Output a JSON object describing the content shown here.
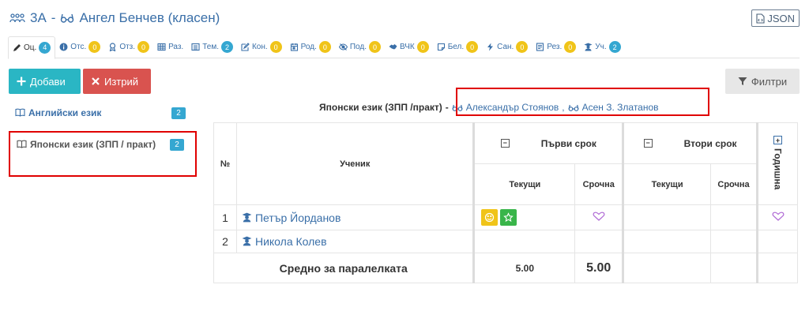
{
  "header": {
    "class_name": "3А",
    "separator": "-",
    "teacher": "Ангел Бенчев (класен)",
    "json_label": "JSON"
  },
  "tabs": [
    {
      "label": "Оц.",
      "count": "4",
      "color": "#35a7d1",
      "icon": "pencil-icon",
      "active": true
    },
    {
      "label": "Отс.",
      "count": "0",
      "color": "#f0c419",
      "icon": "info-icon"
    },
    {
      "label": "Отз.",
      "count": "0",
      "color": "#f0c419",
      "icon": "ribbon-icon"
    },
    {
      "label": "Раз.",
      "count": "",
      "icon": "table-icon"
    },
    {
      "label": "Тем.",
      "count": "2",
      "color": "#35a7d1",
      "icon": "list-icon"
    },
    {
      "label": "Кон.",
      "count": "0",
      "color": "#f0c419",
      "icon": "edit-icon"
    },
    {
      "label": "Род.",
      "count": "0",
      "color": "#f0c419",
      "icon": "calendar-icon"
    },
    {
      "label": "Под.",
      "count": "0",
      "color": "#f0c419",
      "icon": "eye-slash-icon"
    },
    {
      "label": "ВЧК",
      "count": "0",
      "color": "#f0c419",
      "icon": "handshake-icon"
    },
    {
      "label": "Бел.",
      "count": "0",
      "color": "#f0c419",
      "icon": "note-icon"
    },
    {
      "label": "Сан.",
      "count": "0",
      "color": "#f0c419",
      "icon": "bolt-icon"
    },
    {
      "label": "Рез.",
      "count": "0",
      "color": "#f0c419",
      "icon": "report-icon"
    },
    {
      "label": "Уч.",
      "count": "2",
      "color": "#35a7d1",
      "icon": "student-icon"
    }
  ],
  "toolbar": {
    "add_label": "Добави",
    "delete_label": "Изтрий",
    "filter_label": "Филтри"
  },
  "subjects": [
    {
      "name": "Английски език",
      "count": "2"
    },
    {
      "name": "Японски език (ЗПП / практ)",
      "count": "2"
    }
  ],
  "selected": {
    "subject": "Японски език (ЗПП /практ)",
    "dash": "-",
    "teacher1": "Александър Стоянов",
    "comma": ",",
    "teacher2": "Асен З. Златанов"
  },
  "table": {
    "col_no": "№",
    "col_student": "Ученик",
    "term1": "Първи срок",
    "term2": "Втори срок",
    "current": "Текущи",
    "term_grade": "Срочна",
    "year": "Годишна",
    "rows": [
      {
        "no": "1",
        "name": "Петър Йорданов"
      },
      {
        "no": "2",
        "name": "Никола Колев"
      }
    ],
    "avg_label": "Средно за паралелката",
    "avg_current": "5.00",
    "avg_term": "5.00"
  },
  "colors": {
    "accent": "#3a6fa8",
    "add": "#2ab6c4",
    "delete": "#d9534f",
    "badge_yellow": "#f0c419",
    "badge_blue": "#35a7d1",
    "highlight": "#e00000"
  }
}
